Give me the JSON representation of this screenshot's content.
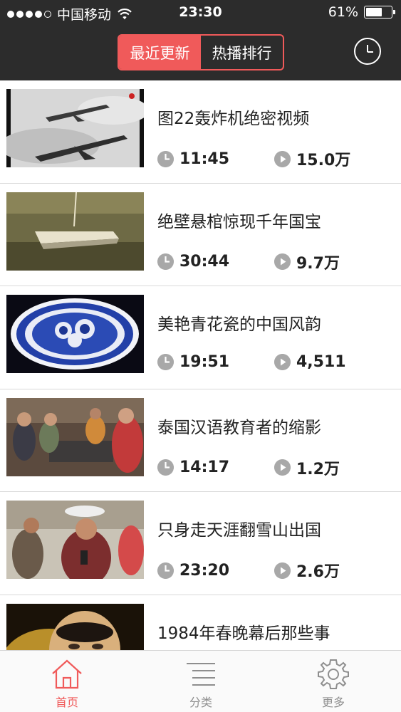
{
  "status_bar": {
    "carrier": "中国移动",
    "time": "23:30",
    "battery": "61%",
    "battery_level": 0.61
  },
  "header": {
    "tabs": [
      {
        "label": "最近更新",
        "active": true
      },
      {
        "label": "热播排行",
        "active": false
      }
    ],
    "history_icon": "clock-icon",
    "accent_color": "#f05a5a",
    "bar_color": "#2c2c2c"
  },
  "videos": [
    {
      "title": "图22轰炸机绝密视频",
      "duration": "11:45",
      "views": "15.0万",
      "thumbnail": "bomber-jets"
    },
    {
      "title": "绝壁悬棺惊现千年国宝",
      "duration": "30:44",
      "views": "9.7万",
      "thumbnail": "hanging-coffin"
    },
    {
      "title": "美艳青花瓷的中国风韵",
      "duration": "19:51",
      "views": "4,511",
      "thumbnail": "blue-white-plate"
    },
    {
      "title": "泰国汉语教育者的缩影",
      "duration": "14:17",
      "views": "1.2万",
      "thumbnail": "group-people"
    },
    {
      "title": "只身走天涯翻雪山出国",
      "duration": "23:20",
      "views": "2.6万",
      "thumbnail": "woman-interview"
    },
    {
      "title": "1984年春晚幕后那些事",
      "duration": "",
      "views": "",
      "thumbnail": "man-portrait"
    }
  ],
  "tabbar": {
    "items": [
      {
        "label": "首页",
        "icon": "home-icon",
        "active": true
      },
      {
        "label": "分类",
        "icon": "list-icon",
        "active": false
      },
      {
        "label": "更多",
        "icon": "gear-icon",
        "active": false
      }
    ]
  }
}
